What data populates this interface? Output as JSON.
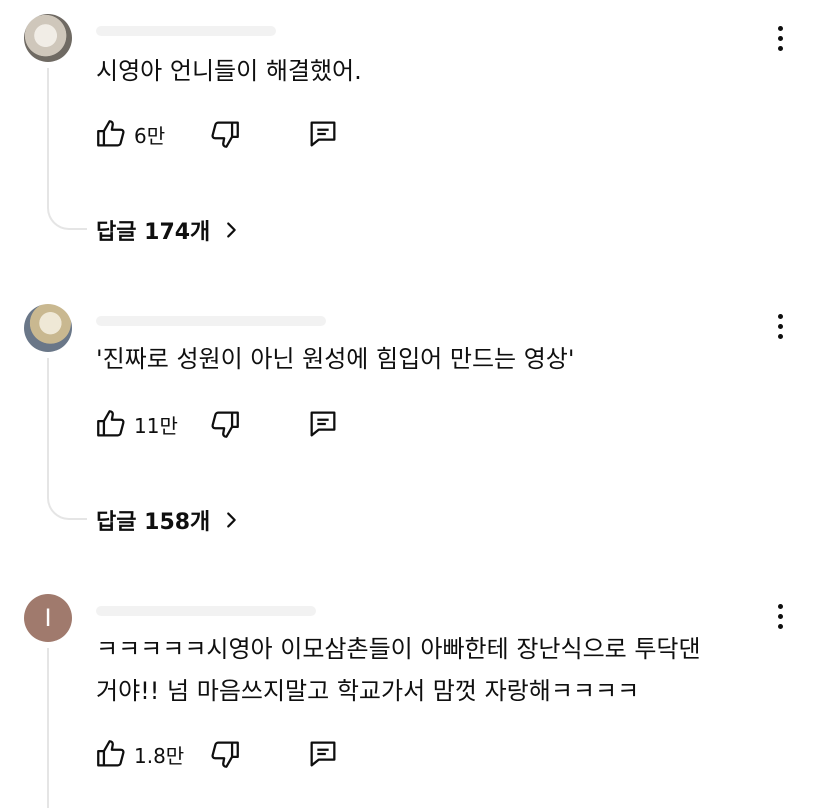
{
  "comments": [
    {
      "avatar": "dog-photo-avatar",
      "text": "시영아 언니들이 해결했어.",
      "likes": "6만",
      "replies_label": "답글 174개"
    },
    {
      "avatar": "person-photo-avatar",
      "text": "'진짜로 성원이 아닌 원성에 힘입어 만드는 영상'",
      "likes": "11만",
      "replies_label": "답글 158개"
    },
    {
      "avatar_letter": "I",
      "avatar_color": "#a07a6d",
      "text": "ㅋㅋㅋㅋㅋ시영아 이모삼촌들이 아빠한테 장난식으로 투닥댄\n거야!! 넘 마음쓰지말고 학교가서 맘껏 자랑해ㅋㅋㅋㅋ",
      "likes": "1.8만"
    }
  ],
  "icons": {
    "like": "thumbs-up-icon",
    "dislike": "thumbs-down-icon",
    "reply": "reply-comment-icon",
    "more": "more-vertical-icon",
    "replies_arrow": "chevron-right-icon"
  }
}
